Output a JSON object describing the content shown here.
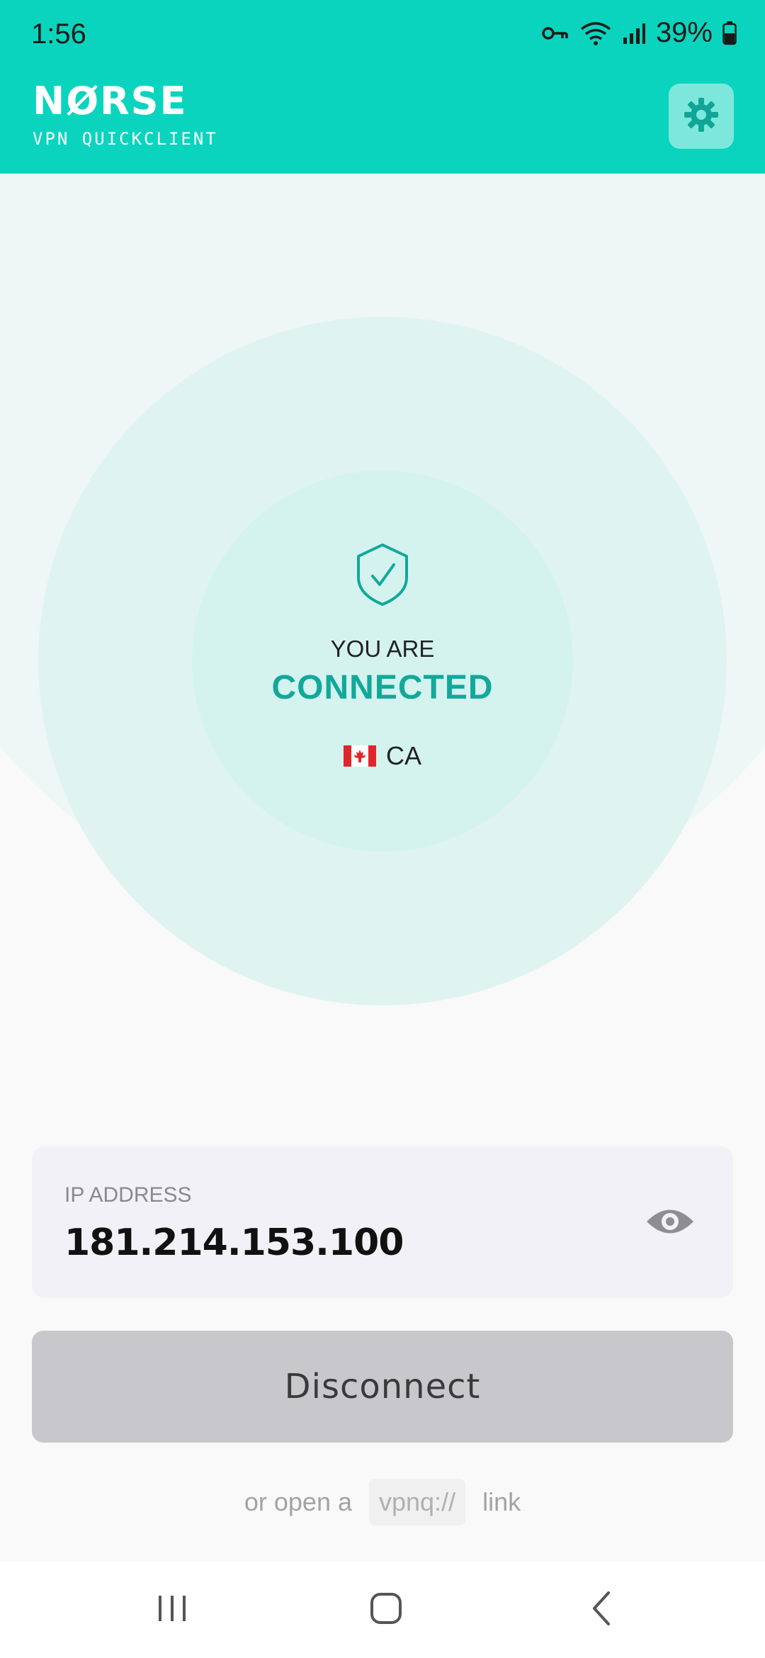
{
  "status_bar": {
    "time": "1:56",
    "battery": "39%",
    "icons": [
      "vpn-key-icon",
      "wifi-icon",
      "signal-icon",
      "battery-icon"
    ]
  },
  "header": {
    "brand_name": "NØRSE",
    "brand_sub": "VPN QUICKCLIENT",
    "settings_icon": "gear-icon",
    "accent_color": "#0bd4be"
  },
  "status": {
    "line1": "YOU ARE",
    "line2": "CONNECTED",
    "country_code": "CA",
    "flag": "canada-flag-icon",
    "status_color": "#12a89a"
  },
  "ip": {
    "label": "IP ADDRESS",
    "value": "181.214.153.100",
    "toggle_icon": "eye-icon"
  },
  "actions": {
    "disconnect_label": "Disconnect"
  },
  "link_hint": {
    "prefix": "or open a",
    "scheme": "vpnq://",
    "suffix": "link"
  },
  "navbar": {
    "icons": [
      "recent-apps-icon",
      "home-icon",
      "back-icon"
    ]
  }
}
